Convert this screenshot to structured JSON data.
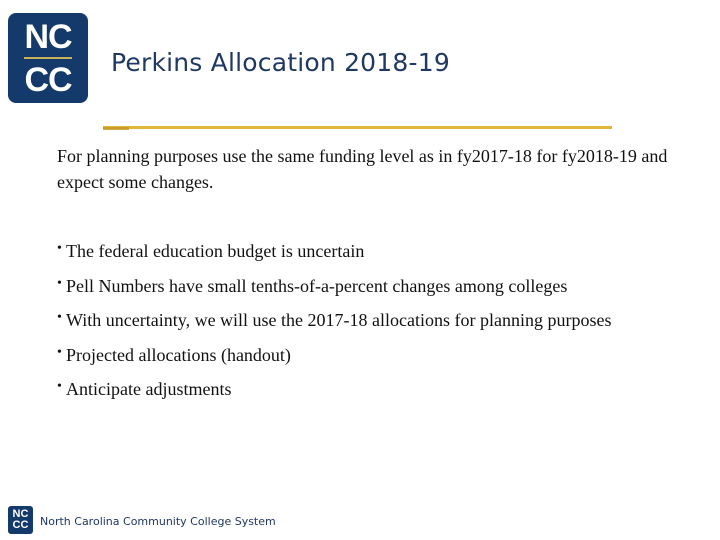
{
  "colors": {
    "brand_navy": "#133a6b",
    "gold": "#e0b53a",
    "gold_dark": "#c79a2a",
    "title_color": "#1f3864"
  },
  "logo": {
    "line1": "NC",
    "line2": "CC"
  },
  "header": {
    "title": "Perkins Allocation 2018-19"
  },
  "intro": {
    "text": "For planning purposes use the same funding level as in fy2017-18 for fy2018-19 and expect some changes."
  },
  "bullets": [
    {
      "marker": "•",
      "text": "The federal education budget is uncertain"
    },
    {
      "marker": "•",
      "text": "Pell Numbers have small tenths-of-a-percent changes among colleges"
    },
    {
      "marker": "•",
      "text": "With uncertainty, we will use the 2017-18 allocations for planning purposes"
    },
    {
      "marker": "•",
      "text": "Projected allocations (handout)"
    },
    {
      "marker": "•",
      "text": "Anticipate adjustments"
    }
  ],
  "footer": {
    "logo_line1": "NC",
    "logo_line2": "CC",
    "text": "North Carolina Community College System"
  }
}
